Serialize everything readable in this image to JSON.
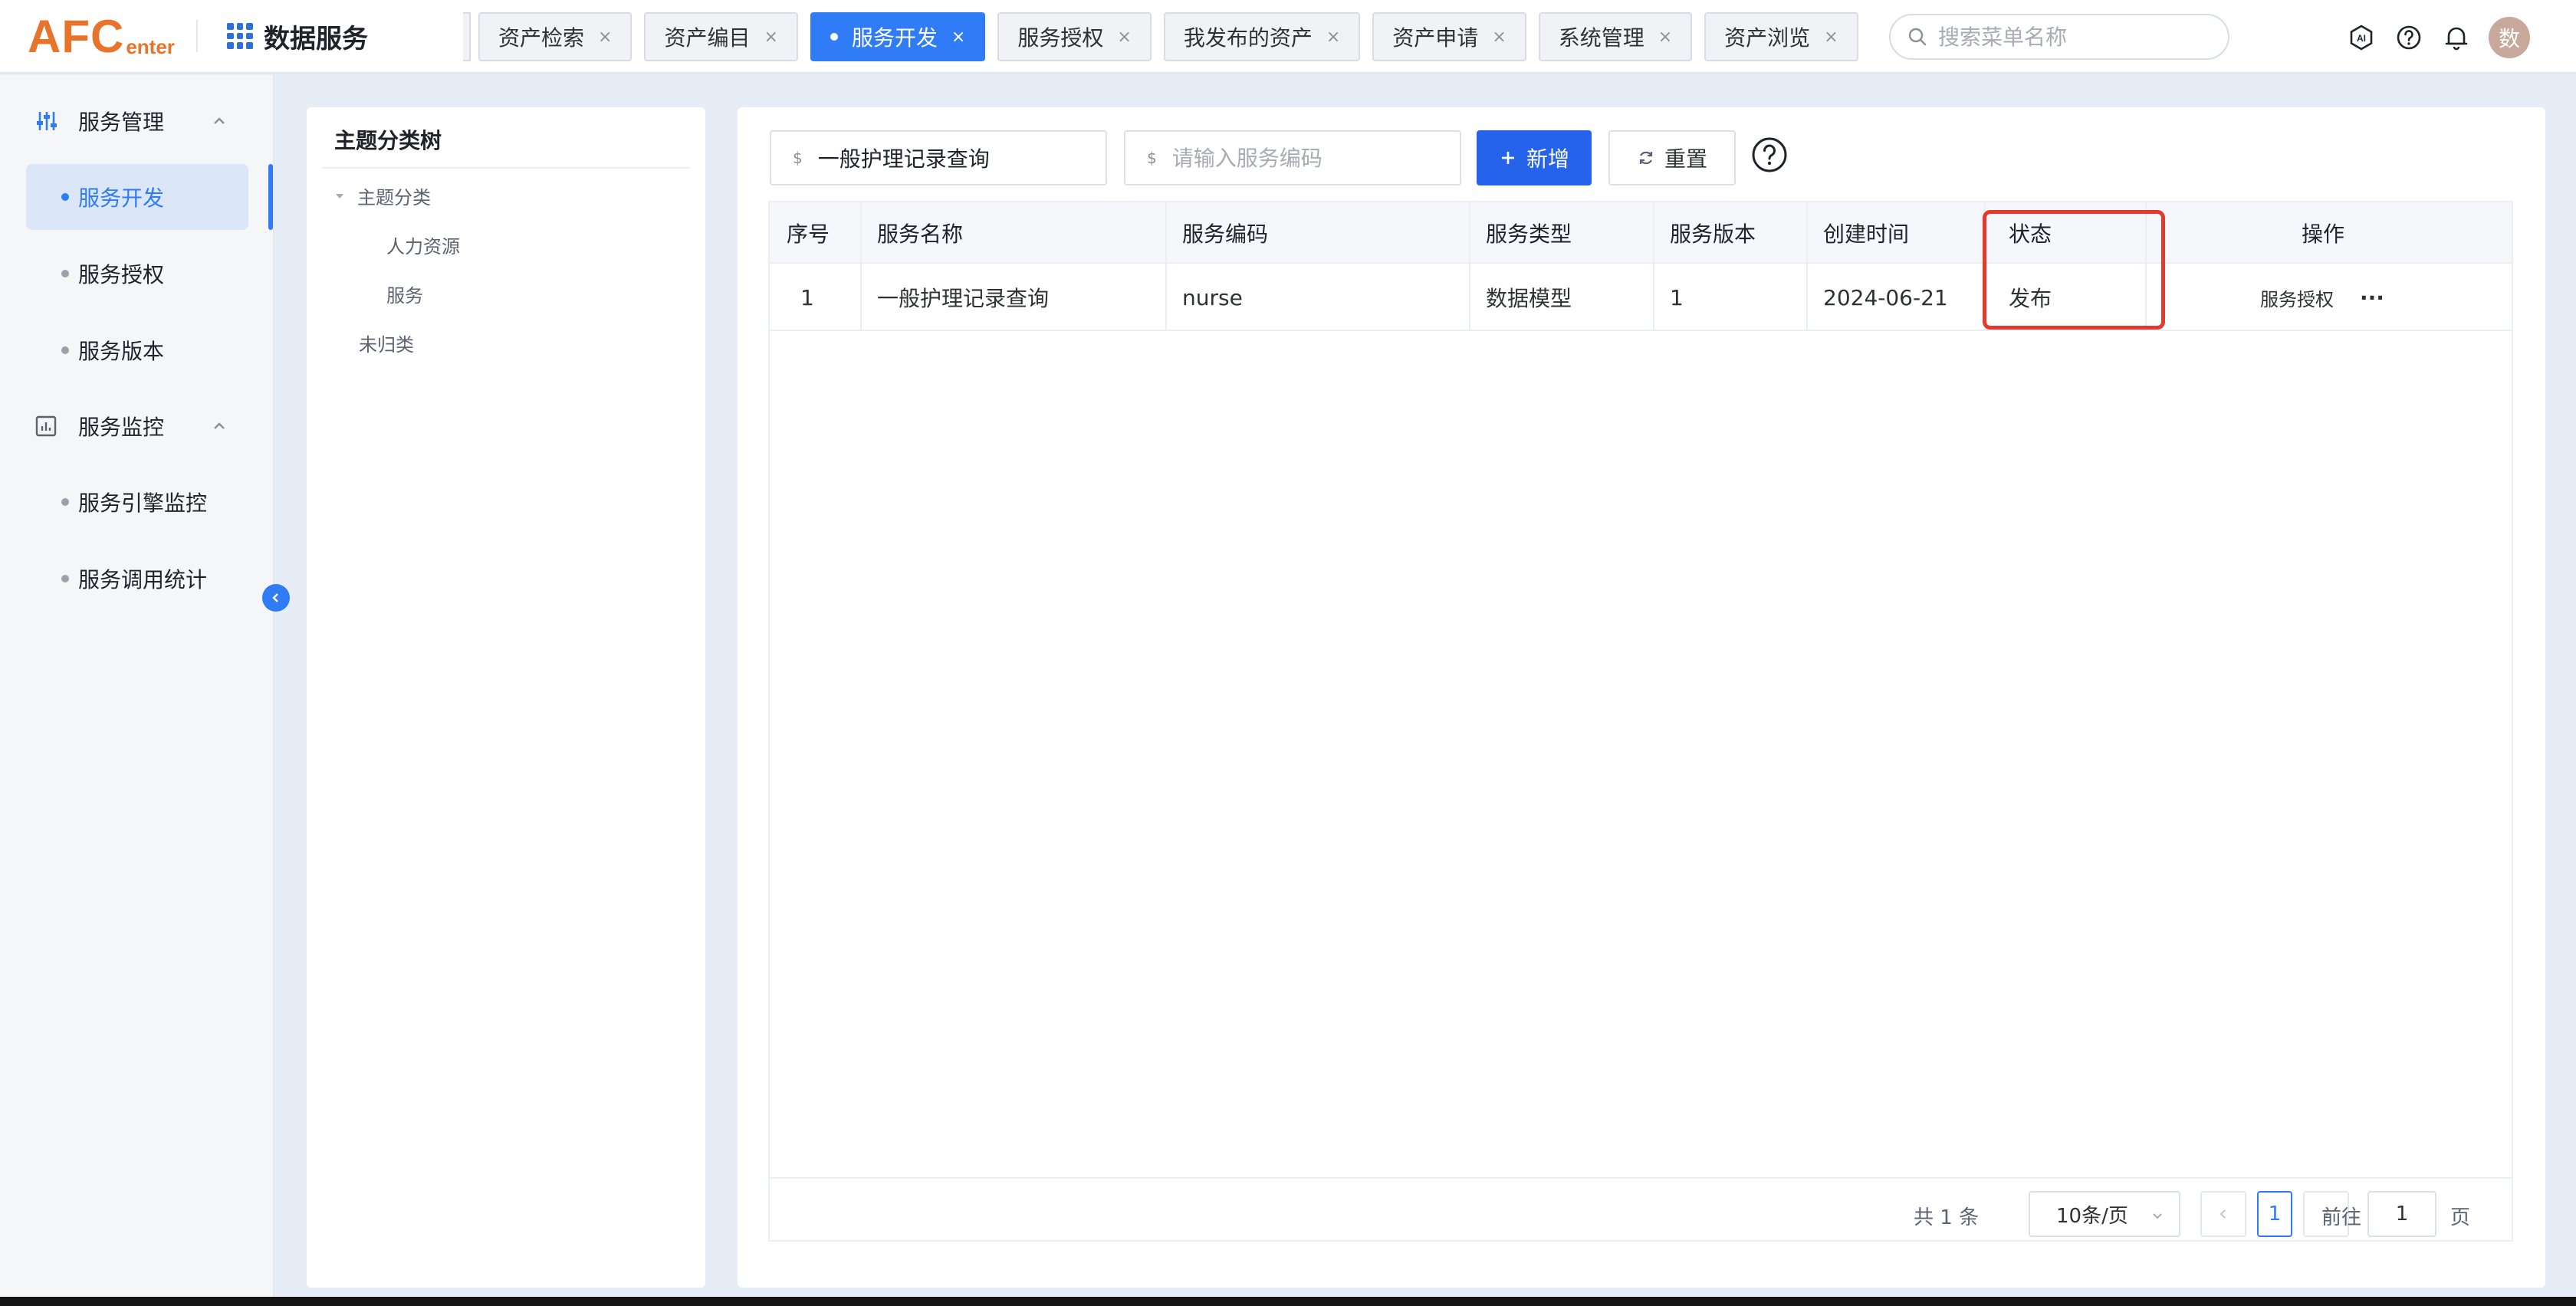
{
  "header": {
    "logo_main": "AFC",
    "logo_sub": "enter",
    "app_title": "数据服务",
    "tabs": [
      {
        "label": "资产检索",
        "active": false
      },
      {
        "label": "资产编目",
        "active": false
      },
      {
        "label": "服务开发",
        "active": true
      },
      {
        "label": "服务授权",
        "active": false
      },
      {
        "label": "我发布的资产",
        "active": false
      },
      {
        "label": "资产申请",
        "active": false
      },
      {
        "label": "系统管理",
        "active": false
      },
      {
        "label": "资产浏览",
        "active": false
      }
    ],
    "tab_close": "×",
    "search_placeholder": "搜索菜单名称",
    "avatar_text": "数",
    "icons": [
      "ai-icon",
      "help-icon",
      "bell-icon"
    ]
  },
  "sidebar": {
    "groups": [
      {
        "label": "服务管理",
        "icon": "sliders-icon"
      },
      {
        "label": "服务监控",
        "icon": "chart-icon"
      }
    ],
    "items": [
      {
        "label": "服务开发",
        "active": true
      },
      {
        "label": "服务授权",
        "active": false
      },
      {
        "label": "服务版本",
        "active": false
      },
      {
        "label": "服务引擎监控",
        "active": false
      },
      {
        "label": "服务调用统计",
        "active": false
      }
    ]
  },
  "tree": {
    "title": "主题分类树",
    "root": "主题分类",
    "children": [
      "人力资源",
      "服务"
    ],
    "other": "未归类"
  },
  "filters": {
    "name_value": "一般护理记录查询",
    "code_placeholder": "请输入服务编码",
    "prefix": "$",
    "add_label": "新增",
    "reset_label": "重置",
    "help_label": "?"
  },
  "table": {
    "columns": [
      "序号",
      "服务名称",
      "服务编码",
      "服务类型",
      "服务版本",
      "创建时间",
      "状态",
      "操作"
    ],
    "rows": [
      {
        "index": "1",
        "name": "一般护理记录查询",
        "code": "nurse",
        "type": "数据模型",
        "version": "1",
        "created": "2024-06-21",
        "status": "发布",
        "op_link": "服务授权",
        "op_more": "···"
      }
    ]
  },
  "pagination": {
    "total_text": "共 1 条",
    "page_size": "10条/页",
    "current_page": "1",
    "goto_label": "前往",
    "goto_value": "1",
    "page_suffix": "页"
  },
  "colors": {
    "accent": "#2f7cf6",
    "primary_button": "#2563eb",
    "logo": "#e8742b",
    "highlight": "#e23b2e"
  }
}
